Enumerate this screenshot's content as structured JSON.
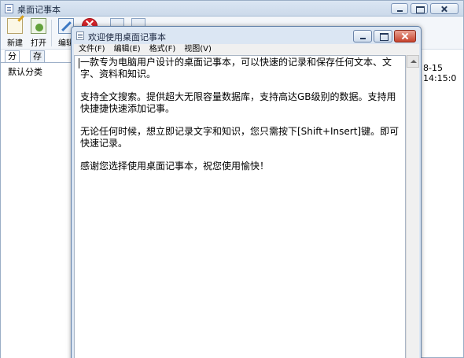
{
  "main_window": {
    "title": "桌面记事本",
    "toolbar": {
      "new_label": "新建",
      "open_label": "打开",
      "edit_label": "编辑"
    },
    "tabs": [
      {
        "label": "分类"
      },
      {
        "label": "存档"
      }
    ],
    "sidebar": {
      "items": [
        {
          "label": "默认分类"
        }
      ]
    },
    "list_date_fragment": "8-15 14:15:0"
  },
  "note_window": {
    "title": "欢迎使用桌面记事本",
    "menu": [
      {
        "label": "文件(F)"
      },
      {
        "label": "编辑(E)"
      },
      {
        "label": "格式(F)"
      },
      {
        "label": "视图(V)"
      }
    ],
    "content": {
      "paragraphs": [
        "一款专为电脑用户设计的桌面记事本，可以快速的记录和保存任何文本、文字、资料和知识。",
        "支持全文搜索。提供超大无限容量数据库，支持高达GB级别的数据。支持用快捷捷快速添加记事。",
        "无论任何时候，想立即记录文字和知识，您只需按下[Shift+Insert]键。即可快速记录。",
        "感谢您选择使用桌面记事本，祝您使用愉快！"
      ]
    }
  },
  "colors": {
    "title_bar": "#dbe6f3",
    "close_red": "#c7432d",
    "delete_red": "#d8232a"
  }
}
